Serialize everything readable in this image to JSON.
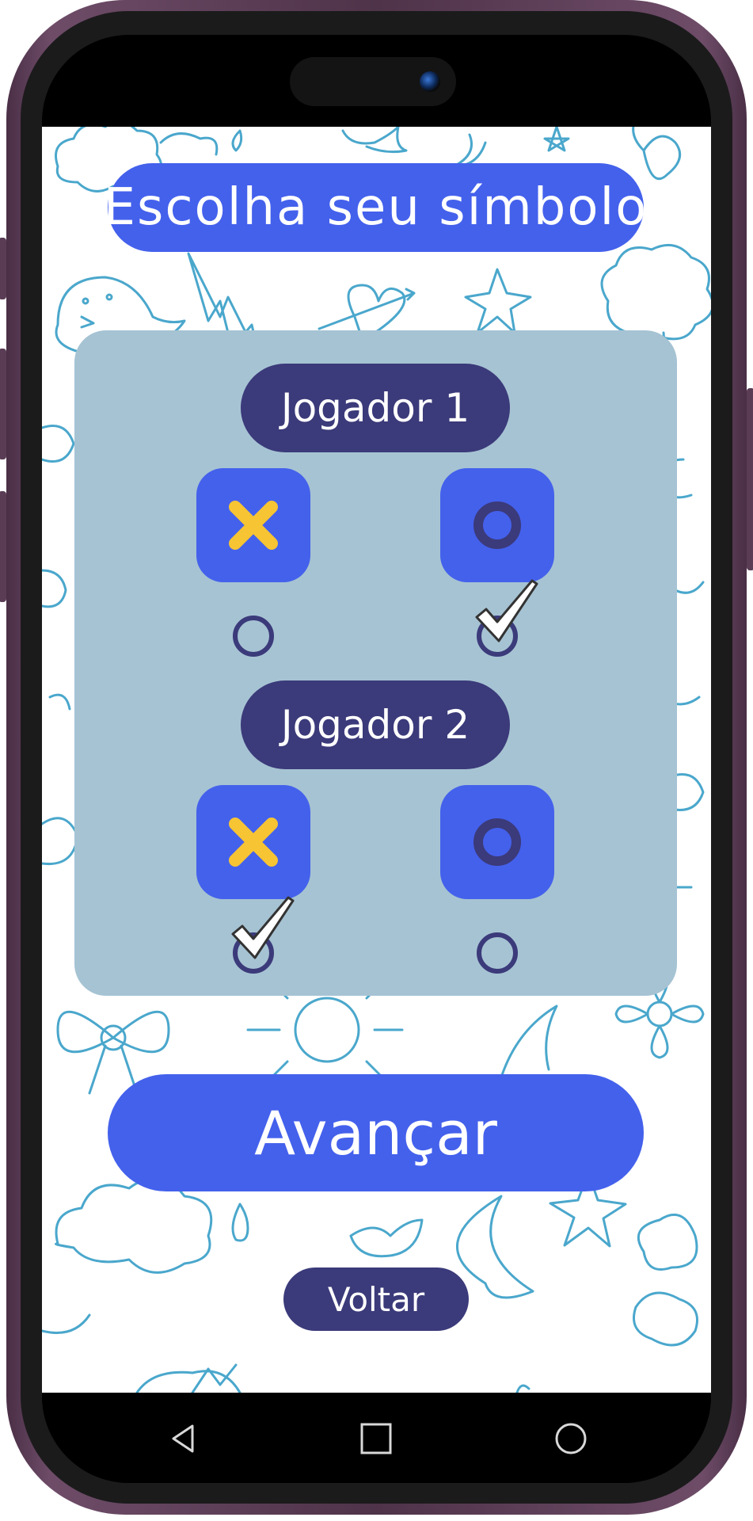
{
  "screen": {
    "title": "Escolha seu símbolo"
  },
  "players": [
    {
      "label": "Jogador 1",
      "options": [
        {
          "symbol": "x-icon",
          "selected": false
        },
        {
          "symbol": "o-icon",
          "selected": true
        }
      ]
    },
    {
      "label": "Jogador 2",
      "options": [
        {
          "symbol": "x-icon",
          "selected": true
        },
        {
          "symbol": "o-icon",
          "selected": false
        }
      ]
    }
  ],
  "actions": {
    "advance_label": "Avançar",
    "back_label": "Voltar"
  },
  "navbar": {
    "back": "triangle-back-icon",
    "home": "square-home-icon",
    "recents": "circle-recents-icon"
  },
  "colors": {
    "primary": "#4461ec",
    "dark": "#3b3a7a",
    "panel": "#a6c3d3",
    "x_symbol": "#f7c433",
    "o_symbol": "#3b3a7a",
    "doodle": "#4aa7cc"
  }
}
